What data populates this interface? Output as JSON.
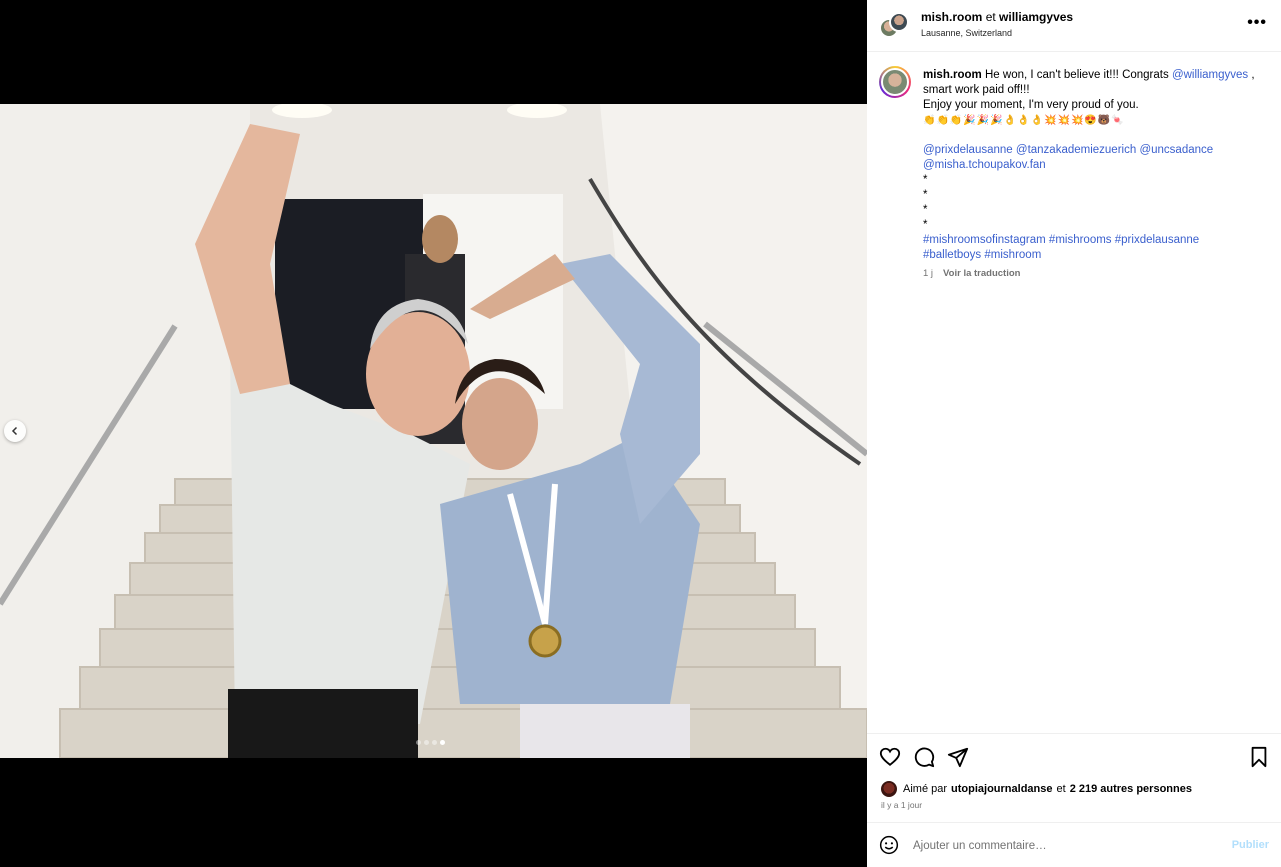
{
  "header": {
    "user1": "mish.room",
    "conj": "et",
    "user2": "williamgyves",
    "location": "Lausanne, Switzerland",
    "more_icon": "more-horizontal-icon",
    "more_label": "•••"
  },
  "caption": {
    "username": "mish.room",
    "line1_text": "He won, I can't believe it!!! Congrats ",
    "line1_mention": "@williamgyves",
    "line1_end": " , smart work paid off!!!",
    "line2": "Enjoy your moment, I'm very proud of you.",
    "emoji_line": "👏👏👏🎉🎉🎉👌👌👌💥💥💥😍🐻🍬",
    "mentions": [
      "@prixdelausanne",
      "@tanzakademiezuerich",
      "@uncsadance",
      "@misha.tchoupakov.fan"
    ],
    "stars": [
      "*",
      "*",
      "*",
      "*"
    ],
    "hashtags": [
      "#mishroomsofinstagram",
      "#mishrooms",
      "#prixdelausanne",
      "#balletboys",
      "#mishroom"
    ],
    "age": "1 j",
    "translate": "Voir la traduction"
  },
  "actions": {
    "like_icon": "heart-icon",
    "comment_icon": "comment-icon",
    "share_icon": "send-icon",
    "save_icon": "bookmark-icon"
  },
  "likes": {
    "prefix": "Aimé par",
    "user": "utopiajournaldanse",
    "conj": "et",
    "count": "2 219 autres personnes"
  },
  "time": "il y a 1 jour",
  "comment": {
    "placeholder": "Ajouter un commentaire…",
    "publish": "Publier",
    "emoji_icon": "smiley-icon"
  },
  "carousel": {
    "total": 4,
    "active_index": 3,
    "prev_icon": "chevron-left-icon"
  }
}
